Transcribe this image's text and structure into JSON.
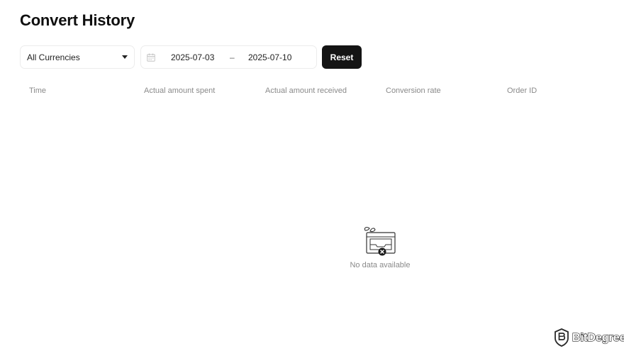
{
  "header": {
    "title": "Convert History"
  },
  "filters": {
    "currency": {
      "selected": "All Currencies",
      "icon": "chevron-down-icon"
    },
    "date_range": {
      "start": "2025-07-03",
      "separator": "–",
      "end": "2025-07-10",
      "icon": "calendar-icon"
    },
    "reset_label": "Reset"
  },
  "table": {
    "columns": [
      "Time",
      "Actual amount spent",
      "Actual amount received",
      "Conversion rate",
      "Order ID"
    ],
    "rows": []
  },
  "empty_state": {
    "icon": "empty-box-icon",
    "message": "No data available"
  },
  "watermark": {
    "brand": "BitDegree",
    "icon": "bitdegree-shield-logo"
  },
  "colors": {
    "primary_button": "#141414",
    "muted_text": "#8a8a8a",
    "border": "#ececec"
  }
}
